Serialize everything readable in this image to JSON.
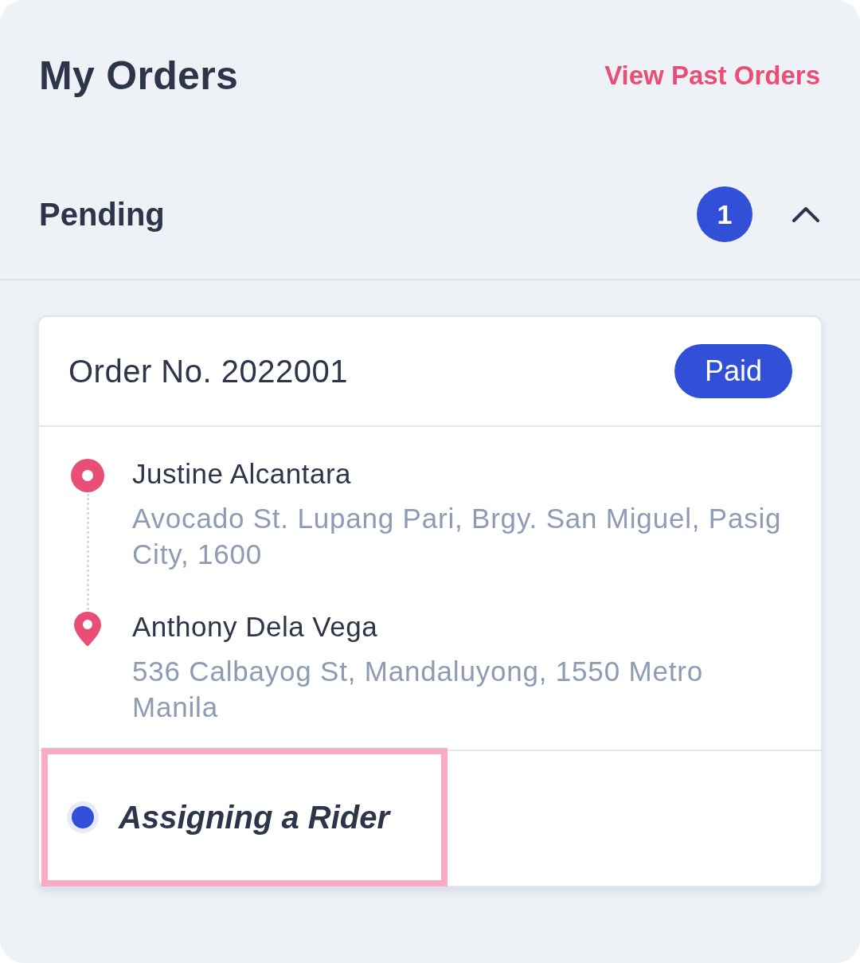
{
  "header": {
    "title": "My Orders",
    "link": "View Past Orders"
  },
  "section": {
    "title": "Pending",
    "count": "1",
    "expanded": true
  },
  "orders": [
    {
      "number_label": "Order No. 2022001",
      "payment_badge": "Paid",
      "stops": [
        {
          "kind": "pickup",
          "name": "Justine Alcantara",
          "address": "Avocado St. Lupang Pari, Brgy. San Miguel, Pasig City, 1600"
        },
        {
          "kind": "dropoff",
          "name": "Anthony Dela Vega",
          "address": "536 Calbayog St, Mandaluyong, 1550 Metro Manila"
        }
      ],
      "status": {
        "label": "Assigning a Rider",
        "highlighted": true
      }
    }
  ]
}
